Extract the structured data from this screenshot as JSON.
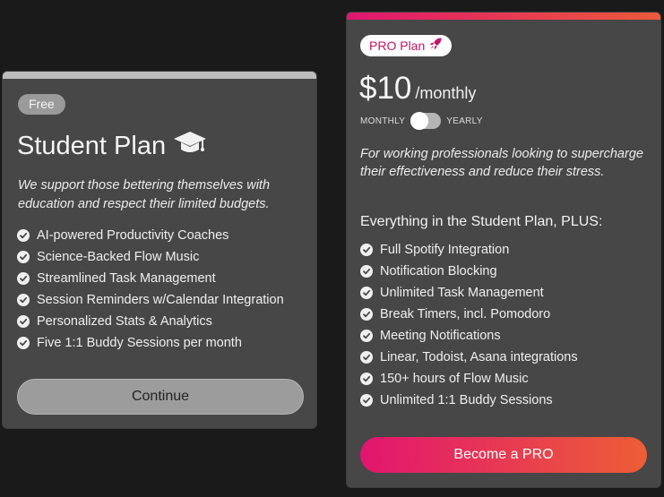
{
  "student_plan": {
    "badge": "Free",
    "title": "Student Plan",
    "title_icon": "graduation-cap-icon",
    "description": "We support those bettering themselves with education and respect their limited budgets.",
    "features": [
      "AI-powered Productivity Coaches",
      "Science-Backed Flow Music",
      "Streamlined Task Management",
      "Session Reminders w/Calendar Integration",
      "Personalized Stats & Analytics",
      "Five 1:1 Buddy Sessions per month"
    ],
    "button_label": "Continue"
  },
  "pro_plan": {
    "badge": "PRO Plan",
    "badge_icon": "rocket-icon",
    "price": "$10",
    "period": "/monthly",
    "billing_toggle": {
      "left_label": "MONTHLY",
      "right_label": "YEARLY",
      "selected": "MONTHLY"
    },
    "description": "For working professionals looking to supercharge their effectiveness and reduce their stress.",
    "features_heading": "Everything in the Student Plan, PLUS:",
    "features": [
      "Full Spotify Integration",
      "Notification Blocking",
      "Unlimited Task Management",
      "Break Timers, incl. Pomodoro",
      "Meeting Notifications",
      "Linear, Todoist, Asana integrations",
      "150+ hours of Flow Music",
      "Unlimited 1:1 Buddy Sessions"
    ],
    "button_label": "Become a PRO"
  },
  "colors": {
    "background": "#1a1a1a",
    "card": "#474747",
    "accent_start": "#e2156f",
    "accent_end": "#ed5e36",
    "free_badge": "#9a9a9a"
  }
}
